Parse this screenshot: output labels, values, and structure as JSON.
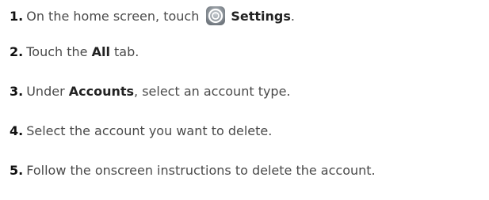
{
  "steps": [
    {
      "number": "1.",
      "pre": "On the home screen, touch",
      "icon": "settings-gear-icon",
      "bold": "Settings",
      "post": "."
    },
    {
      "number": "2.",
      "pre": "Touch the ",
      "bold": "All",
      "post": " tab."
    },
    {
      "number": "3.",
      "pre": "Under ",
      "bold": "Accounts",
      "post": ", select an account type."
    },
    {
      "number": "4.",
      "text": "Select the account you want to delete."
    },
    {
      "number": "5.",
      "text": "Follow the onscreen instructions to delete the account."
    }
  ],
  "colors": {
    "text": "#4a4a4a",
    "number": "#111111",
    "icon_bg": "#8a9097"
  }
}
